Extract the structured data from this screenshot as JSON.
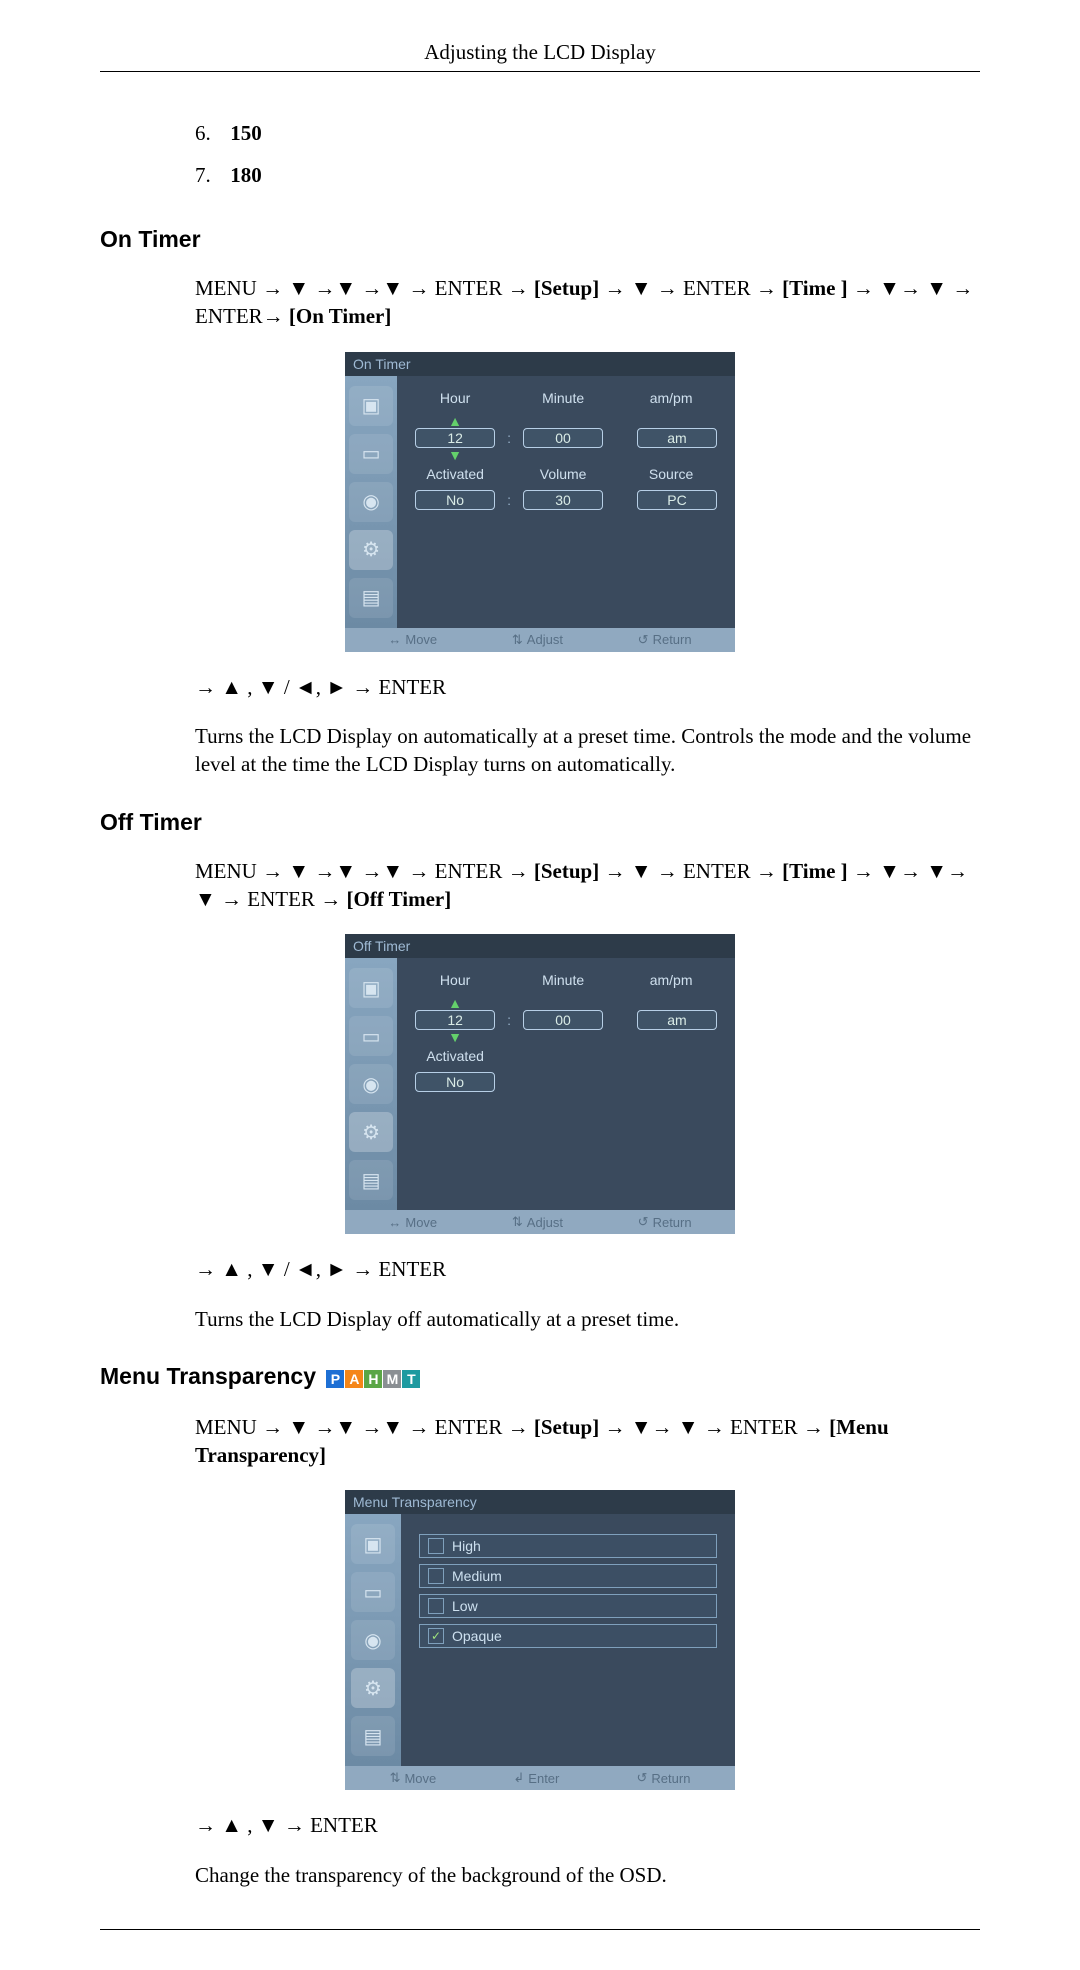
{
  "header": {
    "title": "Adjusting the LCD Display"
  },
  "list_items": [
    {
      "n": "6.",
      "v": "150"
    },
    {
      "n": "7.",
      "v": "180"
    }
  ],
  "sections": {
    "on_timer": {
      "heading": "On Timer",
      "nav_line_a": "MENU → ▼ →▼ →▼ → ENTER → ",
      "nav_setup": "[Setup]",
      "nav_line_b": " → ▼ → ENTER → ",
      "nav_time": "[Time ]",
      "nav_line_c": " → ▼→ ▼ → ENTER→ ",
      "nav_target": "[On Timer]",
      "post_nav": "→ ▲ , ▼ / ◄, ► → ENTER",
      "desc": "Turns the LCD Display on automatically at a preset time. Controls the mode and the volume level at the time the LCD Display turns on automatically."
    },
    "off_timer": {
      "heading": "Off Timer",
      "nav_line_a": "MENU → ▼ →▼ →▼ → ENTER → ",
      "nav_setup": "[Setup]",
      "nav_line_b": " → ▼ → ENTER → ",
      "nav_time": "[Time ]",
      "nav_line_c": " → ▼→ ▼→ ▼ → ENTER → ",
      "nav_target": "[Off Timer]",
      "post_nav": "→ ▲ , ▼ / ◄, ► → ENTER",
      "desc": "Turns the LCD Display off automatically at a preset time."
    },
    "menu_transparency": {
      "heading": "Menu Transparency",
      "nav_line_a": "MENU → ▼ →▼ →▼ → ENTER → ",
      "nav_setup": "[Setup]",
      "nav_line_b": " → ▼→ ▼ → ENTER → ",
      "nav_target": "[Menu Transparency]",
      "post_nav": "→ ▲ , ▼ → ENTER",
      "desc": "Change the transparency of the background of the OSD."
    }
  },
  "osd": {
    "on_timer": {
      "title": "On Timer",
      "labels": {
        "hour": "Hour",
        "minute": "Minute",
        "ampm": "am/pm",
        "activated": "Activated",
        "volume": "Volume",
        "source": "Source"
      },
      "values": {
        "hour": "12",
        "minute": "00",
        "ampm": "am",
        "activated": "No",
        "volume": "30",
        "source": "PC"
      },
      "footer": {
        "move": "Move",
        "adjust": "Adjust",
        "ret": "Return"
      }
    },
    "off_timer": {
      "title": "Off Timer",
      "labels": {
        "hour": "Hour",
        "minute": "Minute",
        "ampm": "am/pm",
        "activated": "Activated"
      },
      "values": {
        "hour": "12",
        "minute": "00",
        "ampm": "am",
        "activated": "No"
      },
      "footer": {
        "move": "Move",
        "adjust": "Adjust",
        "ret": "Return"
      }
    },
    "transparency": {
      "title": "Menu Transparency",
      "options": [
        "High",
        "Medium",
        "Low",
        "Opaque"
      ],
      "selected_index": 3,
      "footer": {
        "move": "Move",
        "enter": "Enter",
        "ret": "Return"
      }
    }
  }
}
